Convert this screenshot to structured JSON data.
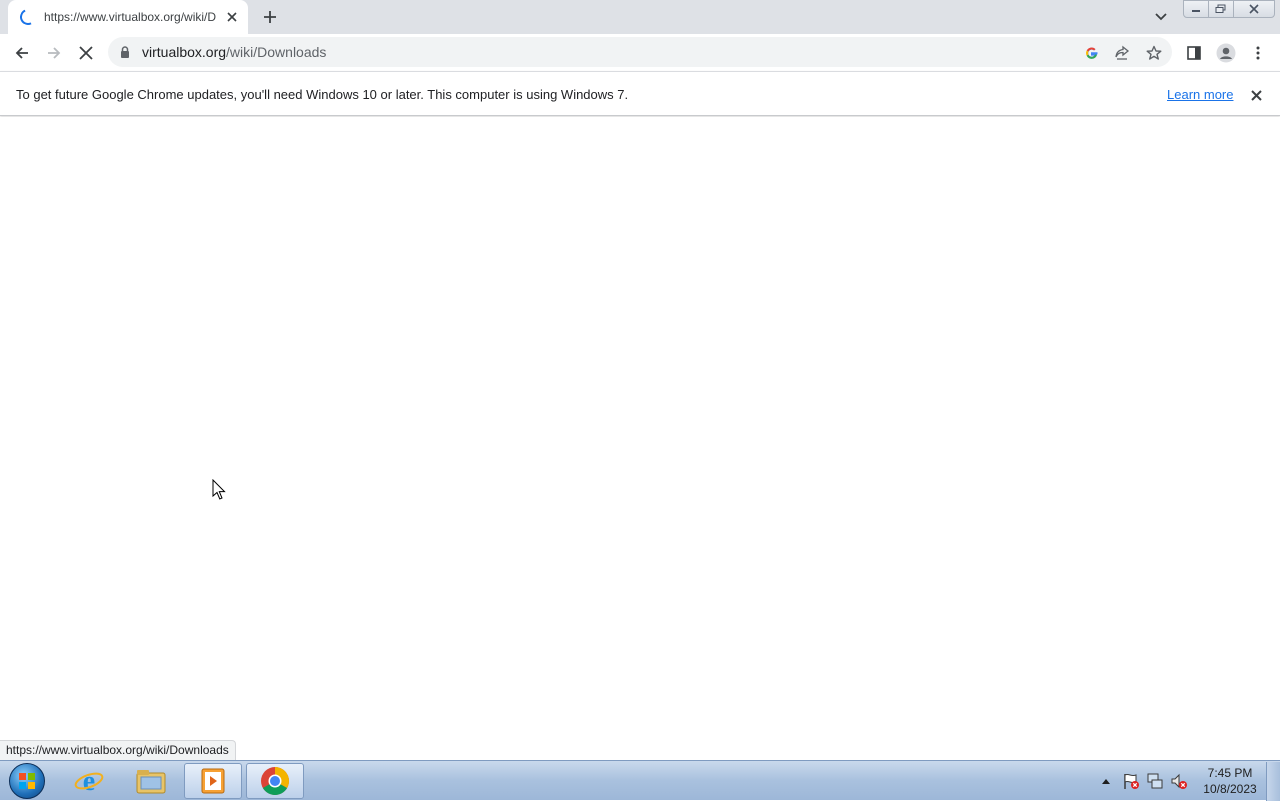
{
  "tab": {
    "title": "https://www.virtualbox.org/wiki/Downloads"
  },
  "omnibox": {
    "domain": "virtualbox.org",
    "path": "/wiki/Downloads"
  },
  "infobar": {
    "message": "To get future Google Chrome updates, you'll need Windows 10 or later. This computer is using Windows 7.",
    "link": "Learn more"
  },
  "status_bar": {
    "url": "https://www.virtualbox.org/wiki/Downloads"
  },
  "taskbar": {
    "apps": [
      "internet-explorer-icon",
      "windows-explorer-icon",
      "media-player-icon",
      "chrome-icon"
    ],
    "clock_time": "7:45 PM",
    "clock_date": "10/8/2023"
  },
  "colors": {
    "accent": "#1a73e8",
    "tabstrip": "#dee1e6",
    "omnibox": "#f1f3f4"
  }
}
